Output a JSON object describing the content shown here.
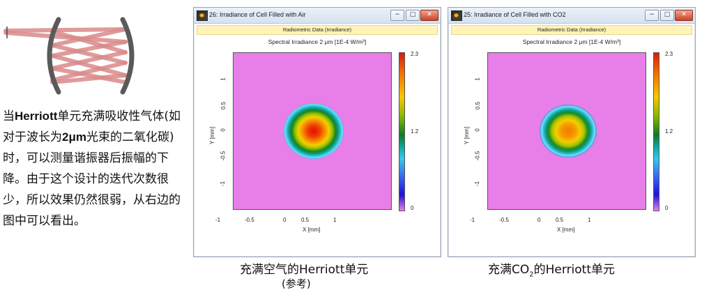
{
  "description": {
    "parts": [
      {
        "text": "当",
        "bold": false
      },
      {
        "text": "Herriott",
        "bold": true
      },
      {
        "text": "单元充满吸收性气体(如对于波长为",
        "bold": false
      },
      {
        "text": "2μm",
        "bold": true
      },
      {
        "text": "光束的二氧化碳)时，可以测量谐振器后振幅的下降。由于这个设计的迭代次数很少，所以效果仍然很弱，从右边的图中可以看出。",
        "bold": false
      }
    ]
  },
  "windows": [
    {
      "title": "26: Irradiance of Cell Filled with Air",
      "subtitle": "Radiometric Data (Irradiance)",
      "plot_title": "Spectral Irradiance 2 μm  [1E-4 W/m³]",
      "xlabel": "X [mm]",
      "ylabel": "Y [mm]",
      "x_ticks": [
        "-1",
        "-0.5",
        "0",
        "0.5",
        "1"
      ],
      "y_ticks": [
        "1",
        "0.5",
        "0",
        "-0.5",
        "-1"
      ],
      "colorbar_ticks": [
        "2.3",
        "1.2",
        "0"
      ],
      "peak": "red",
      "caption_line1": "充满空气的Herriott单元",
      "caption_line2": "(参考)"
    },
    {
      "title": "25: Irradiance of Cell Filled with CO2",
      "subtitle": "Radiometric Data (Irradiance)",
      "plot_title": "Spectral Irradiance 2 μm  [1E-4 W/m³]",
      "xlabel": "X [mm]",
      "ylabel": "Y [mm]",
      "x_ticks": [
        "-1",
        "-0.5",
        "0",
        "0.5",
        "1"
      ],
      "y_ticks": [
        "1",
        "0.5",
        "0",
        "-0.5",
        "-1"
      ],
      "colorbar_ticks": [
        "2.3",
        "1.2",
        "0"
      ],
      "peak": "orange",
      "caption_prefix": "充满CO",
      "caption_sub": "2",
      "caption_suffix": "的Herriott单元"
    }
  ],
  "window_controls": {
    "minimize": "−",
    "maximize": "□",
    "close": "✕"
  },
  "colors": {
    "background": "#e87ee8",
    "title_bar": "#dbe6f3",
    "subtitle_bar": "#fff3b8"
  }
}
